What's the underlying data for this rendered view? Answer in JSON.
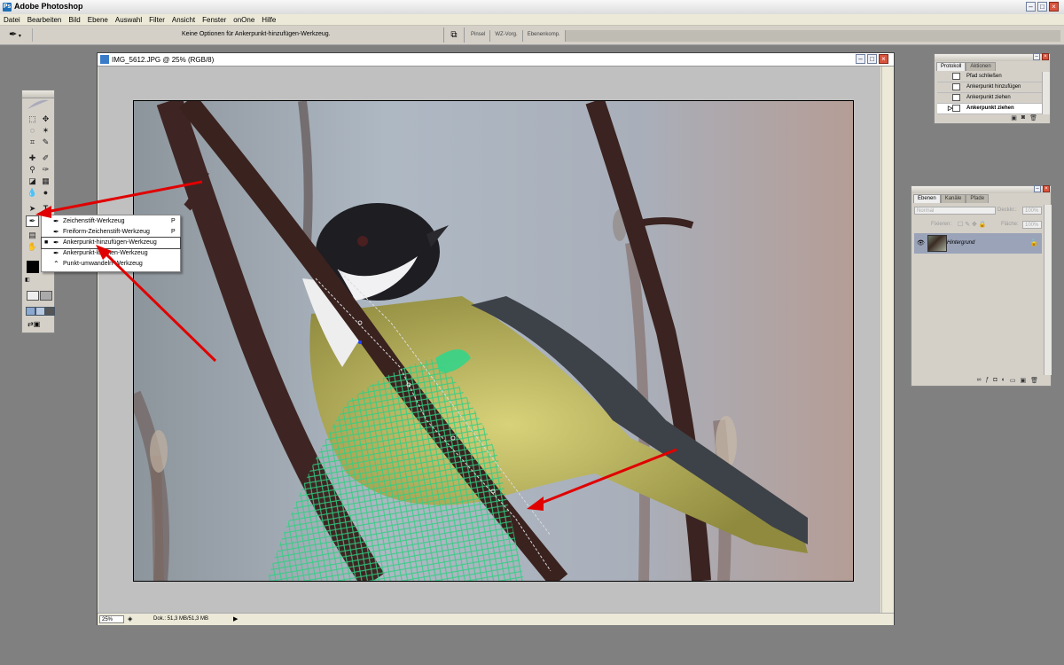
{
  "app": {
    "title": "Adobe Photoshop",
    "icon": "photoshop-icon"
  },
  "menubar": {
    "items": [
      "Datei",
      "Bearbeiten",
      "Bild",
      "Ebene",
      "Auswahl",
      "Filter",
      "Ansicht",
      "Fenster",
      "onOne",
      "Hilfe"
    ]
  },
  "options": {
    "text": "Keine Optionen für Ankerpunkt-hinzufügen-Werkzeug.",
    "well_tabs": [
      "Pinsel",
      "WZ-Vorg.",
      "Ebenenkomp."
    ]
  },
  "document": {
    "title": "IMG_5612.JPG @ 25% (RGB/8)",
    "zoom": "25%",
    "doc_info": "Dok.: 51,3 MB/51,3 MB"
  },
  "flyout": {
    "items": [
      {
        "label": "Zeichenstift-Werkzeug",
        "key": "P",
        "selected": false
      },
      {
        "label": "Freiform-Zeichenstift-Werkzeug",
        "key": "P",
        "selected": false
      },
      {
        "label": "Ankerpunkt-hinzufügen-Werkzeug",
        "key": "",
        "selected": true
      },
      {
        "label": "Ankerpunkt-löschen-Werkzeug",
        "key": "",
        "selected": false
      },
      {
        "label": "Punkt-umwandeln-Werkzeug",
        "key": "",
        "selected": false
      }
    ]
  },
  "protokoll": {
    "tabs": [
      "Protokoll",
      "Aktionen"
    ],
    "items": [
      {
        "label": "Pfad schließen"
      },
      {
        "label": "Ankerpunkt hinzufügen"
      },
      {
        "label": "Ankerpunkt ziehen"
      },
      {
        "label": "Ankerpunkt ziehen"
      }
    ]
  },
  "ebenen": {
    "tabs": [
      "Ebenen",
      "Kanäle",
      "Pfade"
    ],
    "blend_mode": "Normal",
    "opacity_label": "Deckkr.:",
    "opacity": "100%",
    "lock_label": "Fixieren:",
    "fill_label": "Fläche:",
    "fill": "100%",
    "layer": {
      "name": "Hintergrund"
    }
  },
  "colors": {
    "annotation_red": "#e00000",
    "path": "#d9d9d9",
    "net": "#29c77a"
  }
}
